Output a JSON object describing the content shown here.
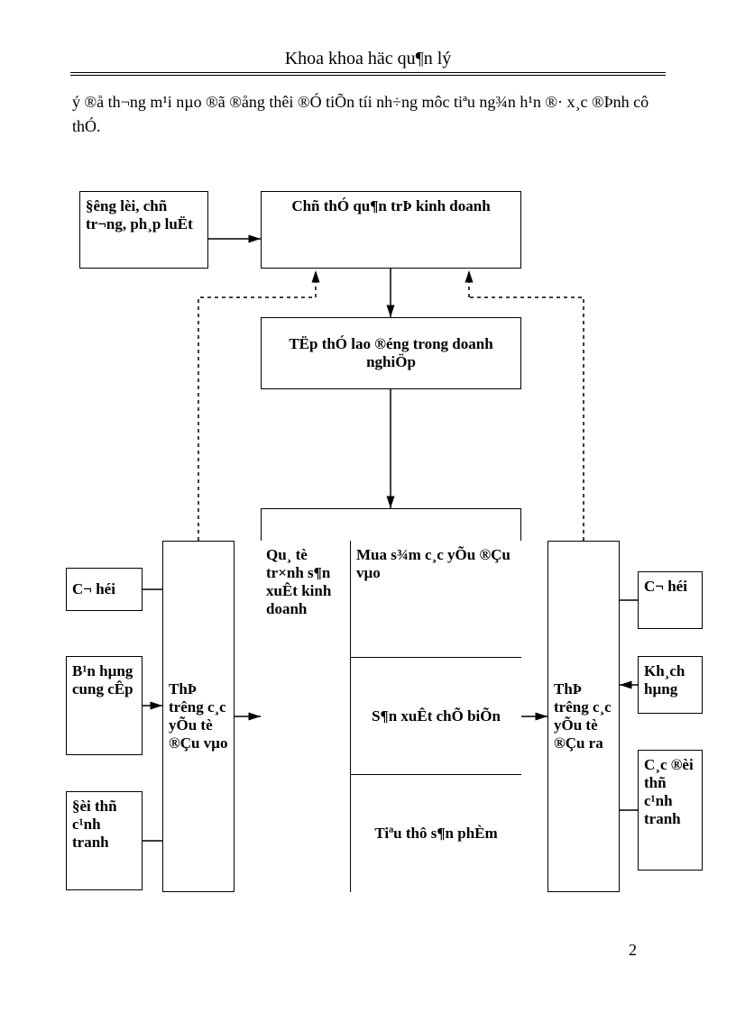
{
  "header": {
    "title": "Khoa khoa häc qu¶n lý"
  },
  "para": {
    "text": "ý ®å th¬ng m¹i nµo ®ã ®ång thêi ®Ó tiÕn tíi nh÷ng môc tiªu ng¾n h¹n ®· x¸c ®Þnh cô thÓ."
  },
  "boxes": {
    "inputAuthority": "§êng lèi, chñ tr¬ng, ph¸p luËt",
    "management": "Chñ thÓ qu¶n trÞ kinh doanh",
    "workforce": "TËp thÓ lao ®éng trong doanh nghiÖp",
    "leftOpp": "C¬ héi",
    "leftSuppliers": "B¹n hµng cung cÊp",
    "leftCompetitors": "§èi thñ c¹nh tranh",
    "inMarket": "ThÞ trêng c¸c yÕu tè ®Çu vµo",
    "processLabel": "Qu¸ tè tr×nh s¶n xuÊt kinh doanh",
    "processBuy": "Mua s¾m c¸c yÕu ®Çu vµo",
    "processProduce": "S¶n xuÊt chÕ biÕn",
    "processDistrib": "Tiªu thô s¶n phÈm",
    "outMarket": "ThÞ trêng c¸c yÕu tè ®Çu ra",
    "rightOpp": "C¬ héi",
    "rightCustomers": "Kh¸ch hµng",
    "rightCompetitors": "C¸c ®èi thñ c¹nh tranh"
  },
  "page": {
    "number": "2"
  }
}
